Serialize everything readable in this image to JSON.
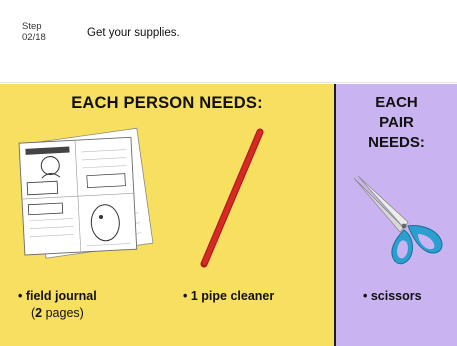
{
  "header": {
    "step_prefix": "Step",
    "step_number": "02/18",
    "title": "Get your supplies."
  },
  "each_person": {
    "heading": "EACH PERSON NEEDS:",
    "items": [
      {
        "label": "• field journal",
        "sub_open": "(",
        "sub_count": "2",
        "sub_rest": " pages)"
      },
      {
        "label": "• 1 pipe cleaner"
      }
    ]
  },
  "each_pair": {
    "heading_line1": "EACH",
    "heading_line2": "PAIR",
    "heading_line3": "NEEDS:",
    "items": [
      {
        "label": "• scissors"
      }
    ]
  },
  "colors": {
    "yellow_panel": "#f7df5f",
    "purple_panel": "#c9b3f0",
    "pipe_cleaner": "#d62a22",
    "scissor_handle": "#2a9fd0"
  },
  "icons": [
    "field-journal-image",
    "pipe-cleaner-image",
    "scissors-image"
  ]
}
